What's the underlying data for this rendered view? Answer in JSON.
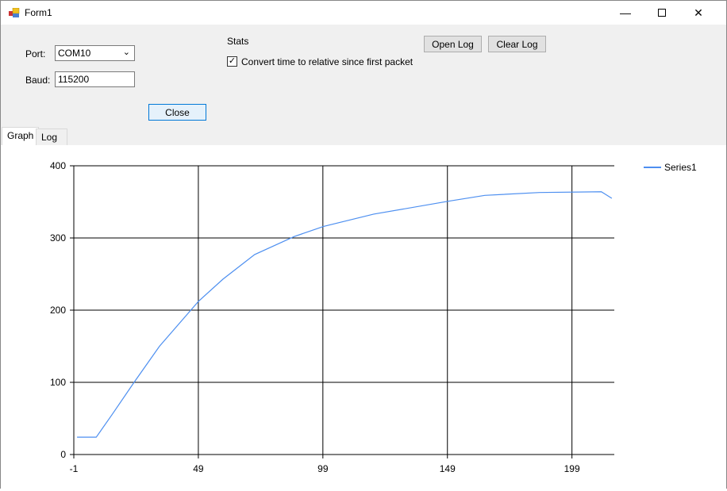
{
  "window": {
    "title": "Form1"
  },
  "form": {
    "port_label": "Port:",
    "port_value": "COM10",
    "baud_label": "Baud:",
    "baud_value": "115200",
    "close_label": "Close",
    "stats_label": "Stats",
    "convert_label": "Convert time to relative since first packet",
    "convert_checked": true,
    "open_log_label": "Open Log",
    "clear_log_label": "Clear Log"
  },
  "tabs": [
    {
      "label": "Graph",
      "active": true
    },
    {
      "label": "Log",
      "active": false
    }
  ],
  "chart_data": {
    "type": "line",
    "xlim": [
      -1,
      216
    ],
    "ylim": [
      0,
      400
    ],
    "xticks": [
      -1,
      49,
      99,
      149,
      199
    ],
    "yticks": [
      0,
      100,
      200,
      300,
      400
    ],
    "grid": true,
    "legend": "top-right",
    "series": [
      {
        "name": "Series1",
        "color": "#4d8ff0",
        "x": [
          0.3,
          8,
          14.3,
          23.2,
          33.4,
          49,
          58.9,
          71.6,
          87.5,
          99.3,
          119.4,
          149.6,
          164,
          186,
          210.8,
          215
        ],
        "y": [
          24,
          24,
          55,
          100,
          150,
          212,
          243,
          277,
          302,
          316,
          333,
          351,
          359,
          363,
          364,
          355
        ]
      }
    ]
  }
}
